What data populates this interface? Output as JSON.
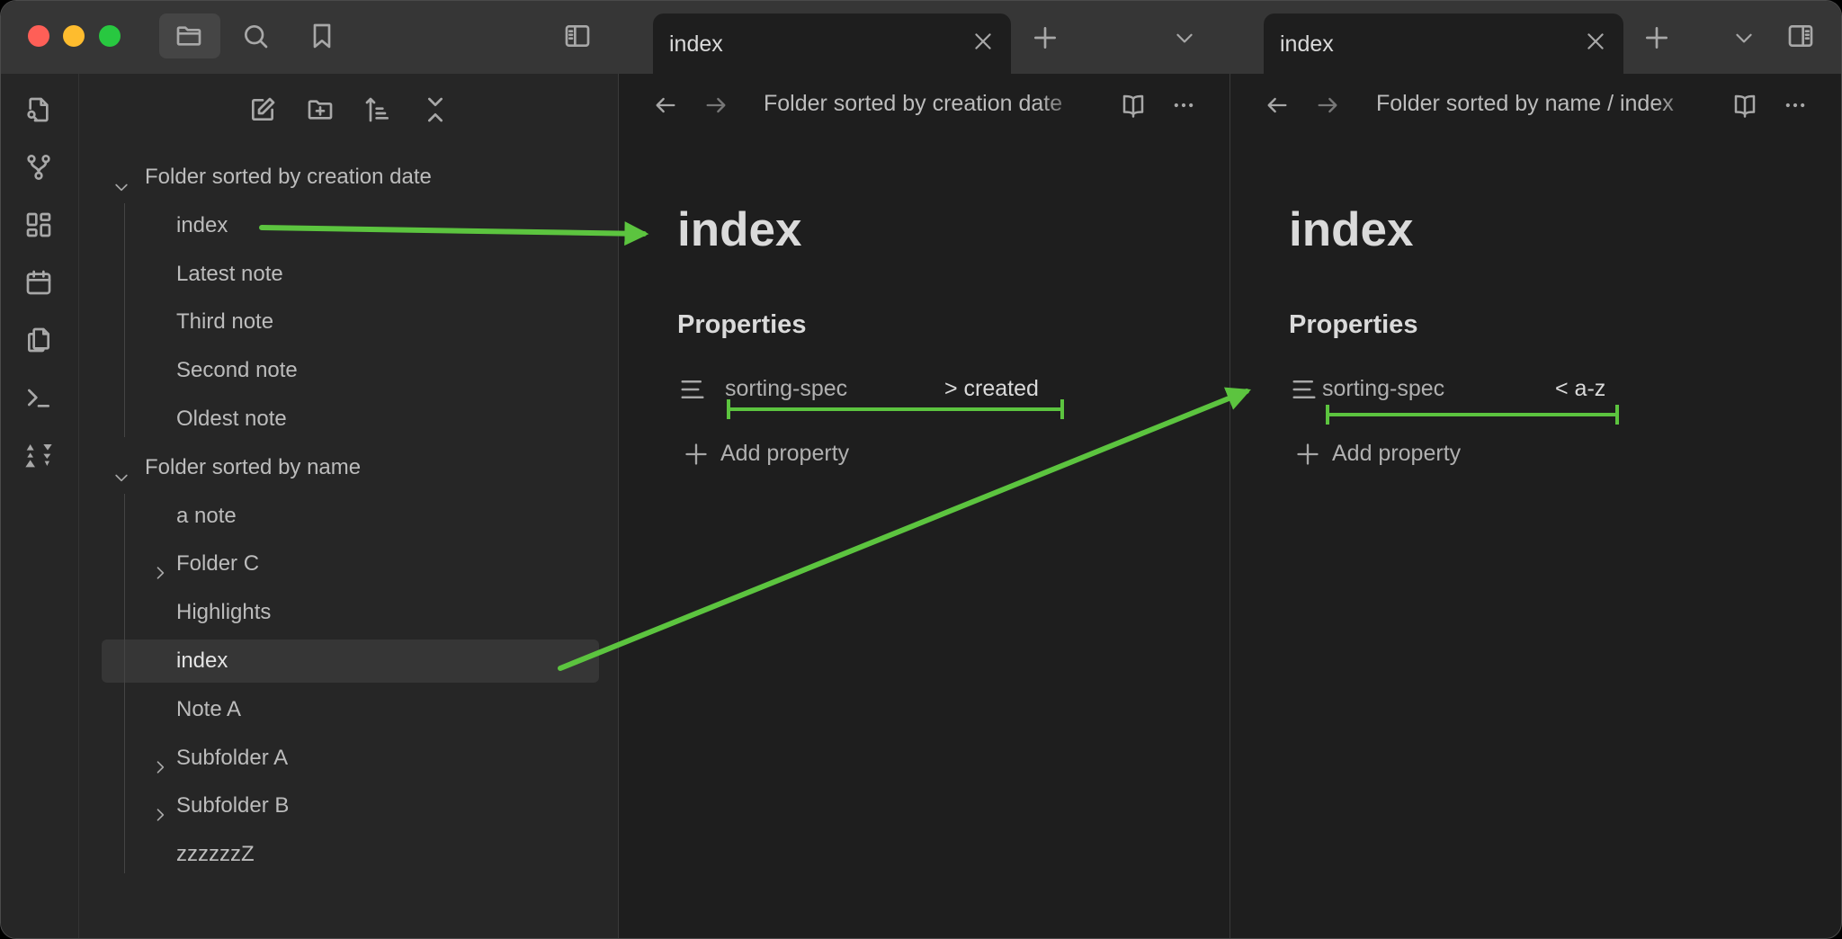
{
  "titlebar": {
    "icons": [
      "folder-icon",
      "search-icon",
      "bookmark-icon",
      "sidebar-toggle-icon"
    ]
  },
  "ribbon": {
    "icons": [
      "file-search-icon",
      "graph-icon",
      "dashboard-icon",
      "calendar-icon",
      "copy-icon",
      "terminal-icon",
      "sort-icon"
    ]
  },
  "sidebar": {
    "toolbar": [
      "new-note-icon",
      "new-folder-icon",
      "sort-icon",
      "collapse-icon"
    ],
    "tree": [
      {
        "label": "Folder sorted by creation date",
        "type": "folder",
        "expanded": true,
        "depth": 0
      },
      {
        "label": "index",
        "type": "file",
        "depth": 1
      },
      {
        "label": "Latest note",
        "type": "file",
        "depth": 1
      },
      {
        "label": "Third note",
        "type": "file",
        "depth": 1
      },
      {
        "label": "Second note",
        "type": "file",
        "depth": 1
      },
      {
        "label": "Oldest note",
        "type": "file",
        "depth": 1
      },
      {
        "label": "Folder sorted by name",
        "type": "folder",
        "expanded": true,
        "depth": 0
      },
      {
        "label": "a note",
        "type": "file",
        "depth": 1
      },
      {
        "label": "Folder C",
        "type": "folder",
        "expanded": false,
        "depth": 1
      },
      {
        "label": "Highlights",
        "type": "file",
        "depth": 1
      },
      {
        "label": "index",
        "type": "file",
        "depth": 1,
        "selected": true
      },
      {
        "label": "Note A",
        "type": "file",
        "depth": 1
      },
      {
        "label": "Subfolder A",
        "type": "folder",
        "expanded": false,
        "depth": 1
      },
      {
        "label": "Subfolder B",
        "type": "folder",
        "expanded": false,
        "depth": 1
      },
      {
        "label": "zzzzzzZ",
        "type": "file",
        "depth": 1
      }
    ]
  },
  "panes": [
    {
      "tab": "index",
      "breadcrumb": "Folder sorted by creation date",
      "title": "index",
      "properties_heading": "Properties",
      "property_key": "sorting-spec",
      "property_value": "> created",
      "add_property": "Add property"
    },
    {
      "tab": "index",
      "breadcrumb": "Folder sorted by name / index",
      "title": "index",
      "properties_heading": "Properties",
      "property_key": "sorting-spec",
      "property_value": "< a-z",
      "add_property": "Add property"
    }
  ],
  "colors": {
    "annotation": "#5cc43f",
    "editor_bg": "#1e1e1e",
    "sidebar_bg": "#262626",
    "titlebar_bg": "#363636",
    "selected_row": "#363636"
  }
}
